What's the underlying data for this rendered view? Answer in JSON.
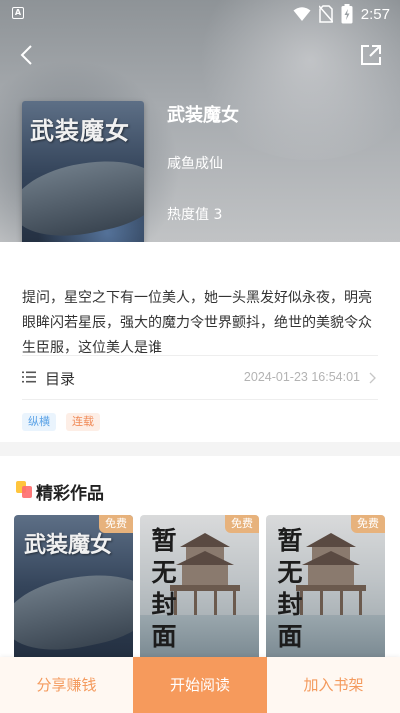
{
  "status_bar": {
    "app_badge": "A",
    "time": "2:57"
  },
  "book": {
    "title": "武装魔女",
    "author": "咸鱼成仙",
    "heat": "热度值 3",
    "cover_title": "武装魔女",
    "description": "提问，星空之下有一位美人，她一头黑发好似永夜，明亮眼眸闪若星辰，强大的魔力令世界颤抖，绝世的美貌令众生臣服，这位美人是谁"
  },
  "toc": {
    "label": "目录",
    "updated": "2024-01-23 16:54:01"
  },
  "tags": [
    "纵横",
    "连载"
  ],
  "featured": {
    "title": "精彩作品",
    "books": [
      {
        "cover_title": "武装魔女",
        "badge": "免费"
      },
      {
        "cover_title": "暂无封面",
        "badge": "免费"
      },
      {
        "cover_title": "暂无封面",
        "badge": "免费"
      }
    ]
  },
  "bottom_bar": {
    "share": "分享赚钱",
    "read": "开始阅读",
    "shelf": "加入书架"
  },
  "colors": {
    "accent": "#f69a5c",
    "tag_blue": "#5aa2e6",
    "tag_orange": "#f08a57"
  }
}
